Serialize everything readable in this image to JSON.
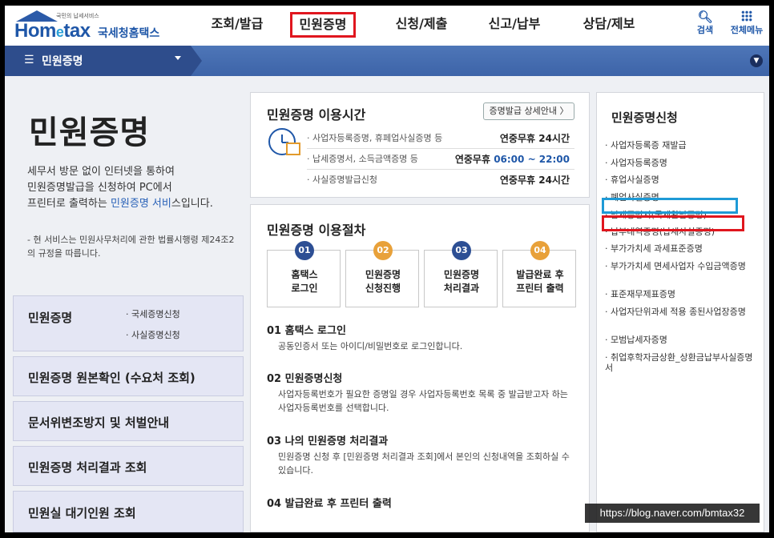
{
  "logo": {
    "tiny": "국민의 납세서비스",
    "brand_pre": "Hom",
    "brand_e": "e",
    "brand_post": "tax",
    "brand_kr": "국세청홈택스"
  },
  "nav": [
    "조회/발급",
    "민원증명",
    "신청/제출",
    "신고/납부",
    "상담/제보"
  ],
  "nav_active": "민원증명",
  "tools": {
    "search": "검색",
    "all_menu": "전체메뉴"
  },
  "subnav": {
    "current": "민원증명"
  },
  "left": {
    "title": "민원증명",
    "intro_a": "세무서 방문 없이 인터넷을 통하여",
    "intro_b": "민원증명발급을 신청하여 PC에서",
    "intro_c1": "프린터로 출력하는 ",
    "intro_c2": "민원증명 서비",
    "intro_c3": "스입니다.",
    "note": "- 현 서비스는 민원사무처리에 관한 법률시행령 제24조2의 규정을 따릅니다.",
    "box1": {
      "title": "민원증명",
      "subs": [
        "· 국세증명신청",
        "· 사실증명신청"
      ]
    },
    "boxes": [
      "민원증명 원본확인 (수요처 조회)",
      "문서위변조방지 및 처벌안내",
      "민원증명 처리결과 조회",
      "민원실 대기인원 조회"
    ]
  },
  "hours": {
    "title": "민원증명 이용시간",
    "detail_btn": "증명발급 상세안내 〉",
    "rows": [
      {
        "k": "· 사업자등록증명, 휴페업사실증명 등",
        "v1": "연중무휴 ",
        "v2": "24시간"
      },
      {
        "k": "· 납세증명서, 소득금액증명 등",
        "v1": "연중무휴 ",
        "v2": "06:00 ~ 22:00"
      },
      {
        "k": "· 사실증명발급신청",
        "v1": "연중무휴 ",
        "v2": "24시간"
      }
    ]
  },
  "proc": {
    "title": "민원증명 이용절차",
    "steps": [
      {
        "n": "01",
        "label": "홈택스\n로그인"
      },
      {
        "n": "02",
        "label": "민원증명\n신청진행"
      },
      {
        "n": "03",
        "label": "민원증명\n처리결과"
      },
      {
        "n": "04",
        "label": "발급완료 후\n프린터 출력"
      }
    ],
    "s1_t": "01 홈택스 로그인",
    "s1_d": "공동인증서 또는 아이디/비밀번호로 로그인합니다.",
    "s2_t": "02 민원증명신청",
    "s2_d": "사업자등록번호가 필요한 증명일 경우 사업자등록번호 목록 중 발급받고자 하는 사업자등록번호를 선택합니다.",
    "s3_t": "03 나의 민원증명 처리결과",
    "s3_d": "민원증명 신청 후 [민원증명 처리결과 조회]에서 본인의 신청내역을 조회하실 수 있습니다.",
    "s4_t": "04 발급완료 후 프린터 출력"
  },
  "right": {
    "title": "민원증명신청",
    "items": [
      "사업자등록증 재발급",
      "사업자등록증명",
      "휴업사실증명",
      "폐업사실증명",
      "납세증명서(국세완납증명)",
      "납부내역증명(납세사실증명)",
      "부가가치세 과세표준증명",
      "부가가치세 면세사업자 수입금액증명",
      "표준재무제표증명",
      "사업자단위과세 적용 종된사업장증명",
      "모범납세자증명",
      "취업후학자금상환_상환금납부사실증명서"
    ]
  },
  "watermark": "https://blog.naver.com/bmtax32"
}
